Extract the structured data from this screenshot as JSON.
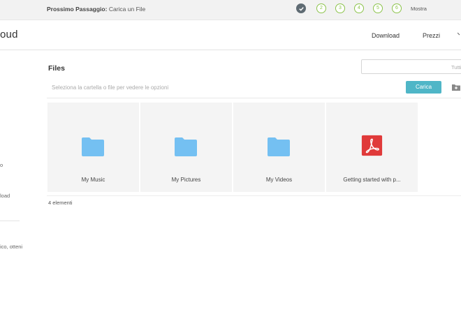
{
  "topbar": {
    "next_step_label": "Prossimo Passaggio:",
    "next_step_value": "Carica un File",
    "steps": [
      "2",
      "3",
      "4",
      "5",
      "6"
    ],
    "show_label": "Mostra"
  },
  "header": {
    "logo_text": "oud",
    "nav": [
      "Download",
      "Prezzi"
    ]
  },
  "sidebar": {
    "items": [
      "o",
      "load",
      "ico, otteni"
    ]
  },
  "main": {
    "title": "Files",
    "search_placeholder": "Tutti",
    "hint": "Seleziona la cartella o file per vedere le opzioni",
    "upload_label": "Carica",
    "items": [
      {
        "label": "My Music",
        "icon": "folder-icon"
      },
      {
        "label": "My Pictures",
        "icon": "folder-icon"
      },
      {
        "label": "My Videos",
        "icon": "folder-icon"
      },
      {
        "label": "Getting started with p...",
        "icon": "pdf-icon"
      }
    ],
    "count": "4 elementi"
  },
  "colors": {
    "accent": "#4fb6c7",
    "folder": "#74c0f2",
    "pdf": "#e03a3a",
    "step_green": "#8bc34a",
    "step_done": "#5f6b73"
  }
}
